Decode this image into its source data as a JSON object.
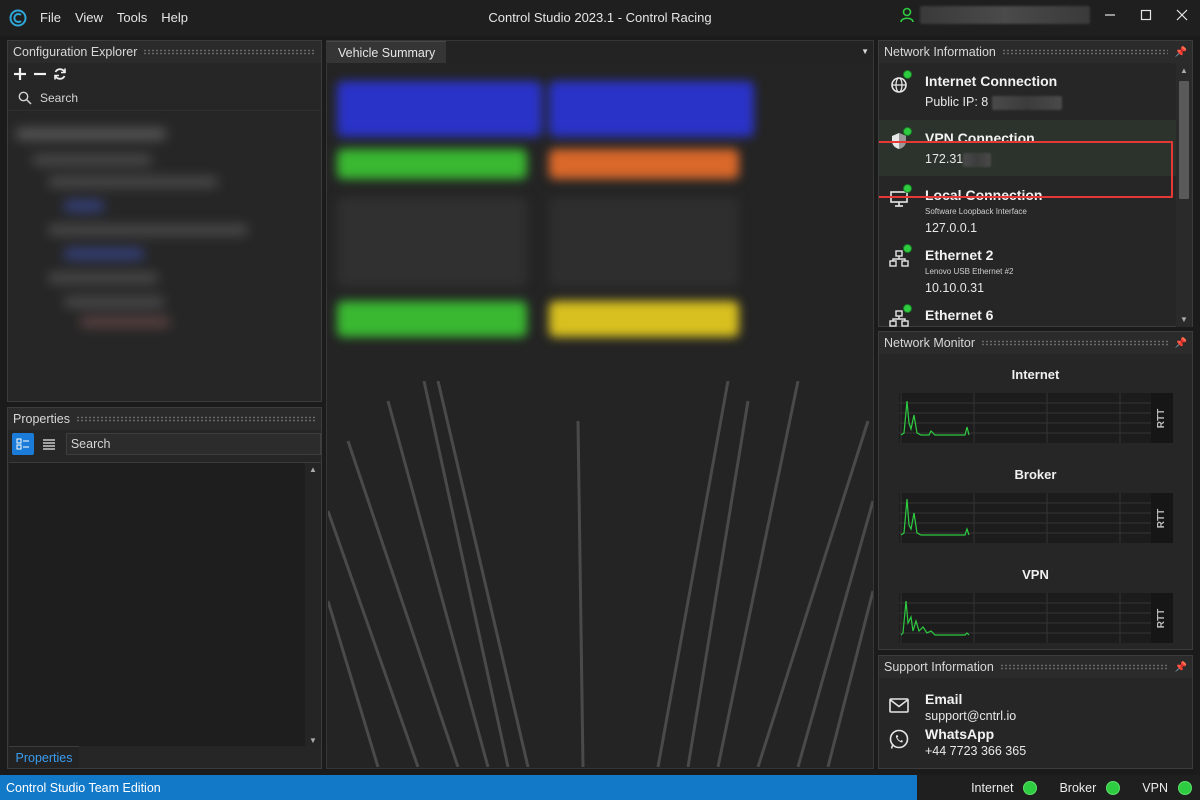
{
  "app": {
    "title": "Control Studio 2023.1 - Control Racing",
    "menu": [
      "File",
      "View",
      "Tools",
      "Help"
    ],
    "accent_color": "#1279c9",
    "status_green": "#2ecc40",
    "highlight_border": "#e53935"
  },
  "config_explorer": {
    "title": "Configuration Explorer",
    "toolbar_icons": [
      "plus-icon",
      "minus-icon",
      "refresh-icon"
    ],
    "search_label": "Search"
  },
  "properties": {
    "title": "Properties",
    "search_label": "Search",
    "tab_label": "Properties"
  },
  "document": {
    "tab_label": "Vehicle Summary"
  },
  "network_info": {
    "title": "Network Information",
    "items": [
      {
        "title": "Internet Connection",
        "value_prefix": "Public IP: 8",
        "icon": "globe-icon"
      },
      {
        "title": "VPN Connection",
        "value_prefix": "172.31",
        "icon": "shield-icon"
      },
      {
        "title": "Local Connection",
        "subtitle": "Software Loopback Interface",
        "value": "127.0.0.1",
        "icon": "monitor-icon"
      },
      {
        "title": "Ethernet 2",
        "subtitle": "Lenovo USB Ethernet #2",
        "value": "10.10.0.31",
        "icon": "network-icon"
      },
      {
        "title": "Ethernet 6",
        "icon": "network-icon"
      }
    ]
  },
  "network_monitor": {
    "title": "Network Monitor",
    "charts": [
      {
        "title": "Internet",
        "axis_label": "RTT"
      },
      {
        "title": "Broker",
        "axis_label": "RTT"
      },
      {
        "title": "VPN",
        "axis_label": "RTT"
      }
    ]
  },
  "support": {
    "title": "Support Information",
    "email_label": "Email",
    "email": "support@cntrl.io",
    "whatsapp_label": "WhatsApp",
    "whatsapp": "+44 7723 366 365"
  },
  "statusbar": {
    "edition": "Control Studio Team Edition",
    "indicators": [
      "Internet",
      "Broker",
      "VPN"
    ]
  }
}
